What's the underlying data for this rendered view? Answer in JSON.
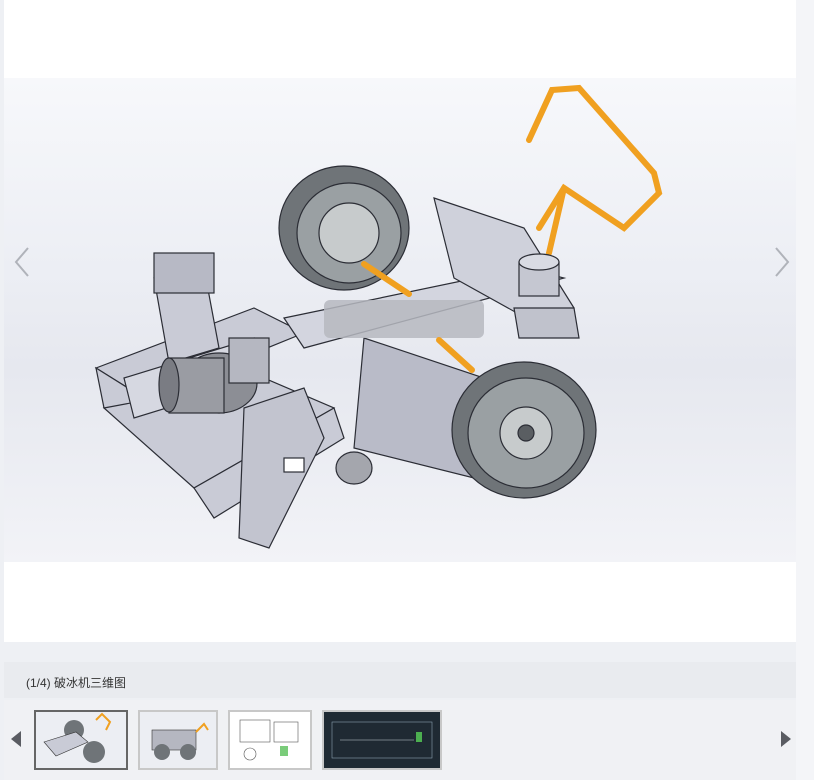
{
  "viewer": {
    "caption": "(1/4) 破冰机三维图",
    "current_index": 1,
    "total": 4
  },
  "thumbnails": [
    {
      "name": "thumb-1",
      "kind": "3d-render",
      "selected": true
    },
    {
      "name": "thumb-2",
      "kind": "3d-render",
      "selected": false
    },
    {
      "name": "thumb-3",
      "kind": "drawing-white",
      "selected": false
    },
    {
      "name": "thumb-4",
      "kind": "drawing-dark",
      "selected": false
    }
  ],
  "colors": {
    "accent_handle": "#f0a020",
    "frame": "#c4c6d2",
    "tire": "#7f8488",
    "dark_thumb_bg": "#1f2a33"
  },
  "icons": {
    "prev": "chevron-left-icon",
    "next": "chevron-right-icon",
    "strip_prev": "triangle-left-icon",
    "strip_next": "triangle-right-icon"
  }
}
